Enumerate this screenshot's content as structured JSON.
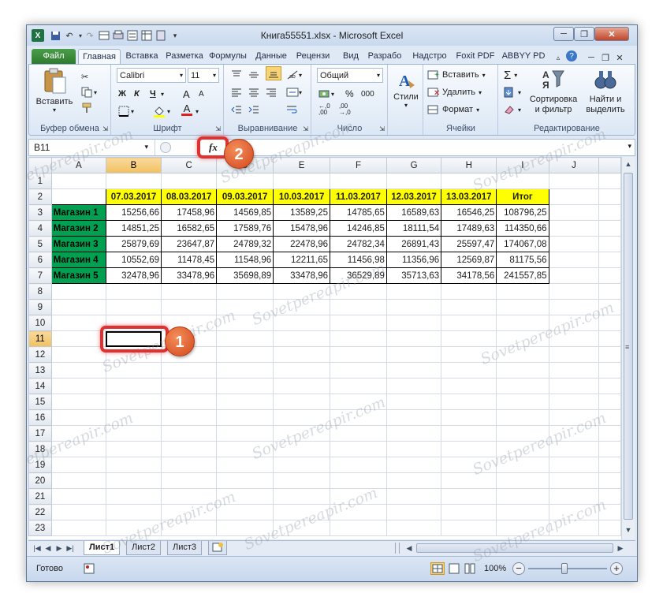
{
  "app": {
    "title": "Книга55551.xlsx - Microsoft Excel",
    "logo": "X"
  },
  "ribbon_tabs": [
    "Файл",
    "Главная",
    "Вставка",
    "Разметка",
    "Формулы",
    "Данные",
    "Рецензи",
    "Вид",
    "Разрабо",
    "Надстро",
    "Foxit PDF",
    "ABBYY PD"
  ],
  "ribbon": {
    "clipboard": {
      "paste": "Вставить",
      "label": "Буфер обмена"
    },
    "font": {
      "name": "Calibri",
      "size": "11",
      "bold": "Ж",
      "italic": "К",
      "underline": "Ч",
      "label": "Шрифт",
      "grow": "A",
      "color_a": "A"
    },
    "alignment": {
      "label": "Выравнивание"
    },
    "number": {
      "format": "Общий",
      "percent": "%",
      "thousands": "000",
      "label": "Число"
    },
    "styles": {
      "button": "Стили"
    },
    "cells": {
      "insert": "Вставить",
      "delete": "Удалить",
      "format": "Формат",
      "label": "Ячейки"
    },
    "editing": {
      "sum": "Σ",
      "sort": "Сортировка и фильтр",
      "find": "Найти и выделить",
      "label": "Редактирование"
    }
  },
  "formula_bar": {
    "name_box": "B11",
    "fx": "fx",
    "formula": ""
  },
  "columns": [
    "A",
    "B",
    "C",
    "D",
    "E",
    "F",
    "G",
    "H",
    "I",
    "J"
  ],
  "rows": [
    "1",
    "2",
    "3",
    "4",
    "5",
    "6",
    "7",
    "8",
    "9",
    "10",
    "11",
    "12",
    "13",
    "14",
    "15",
    "16",
    "17",
    "18",
    "19",
    "20",
    "21",
    "22",
    "23"
  ],
  "table": {
    "headers": [
      "07.03.2017",
      "08.03.2017",
      "09.03.2017",
      "10.03.2017",
      "11.03.2017",
      "12.03.2017",
      "13.03.2017",
      "Итог"
    ],
    "data": [
      {
        "store": "Магазин 1",
        "values": [
          "15256,66",
          "17458,96",
          "14569,85",
          "13589,25",
          "14785,65",
          "16589,63",
          "16546,25",
          "108796,25"
        ]
      },
      {
        "store": "Магазин 2",
        "values": [
          "14851,25",
          "16582,65",
          "17589,76",
          "15478,96",
          "14246,85",
          "18111,54",
          "17489,63",
          "114350,66"
        ]
      },
      {
        "store": "Магазин 3",
        "values": [
          "25879,69",
          "23647,87",
          "24789,32",
          "22478,96",
          "24782,34",
          "26891,43",
          "25597,47",
          "174067,08"
        ]
      },
      {
        "store": "Магазин 4",
        "values": [
          "10552,69",
          "11478,45",
          "11548,96",
          "12211,65",
          "11456,98",
          "11356,96",
          "12569,87",
          "81175,56"
        ]
      },
      {
        "store": "Магазин 5",
        "values": [
          "32478,96",
          "33478,96",
          "35698,89",
          "33478,96",
          "36529,89",
          "35713,63",
          "34178,56",
          "241557,85"
        ]
      }
    ]
  },
  "sheet_tabs": [
    "Лист1",
    "Лист2",
    "Лист3"
  ],
  "status": {
    "ready": "Готово",
    "zoom": "100%"
  },
  "markers": [
    "1",
    "2"
  ],
  "watermark": "Sovetpereapir.com"
}
